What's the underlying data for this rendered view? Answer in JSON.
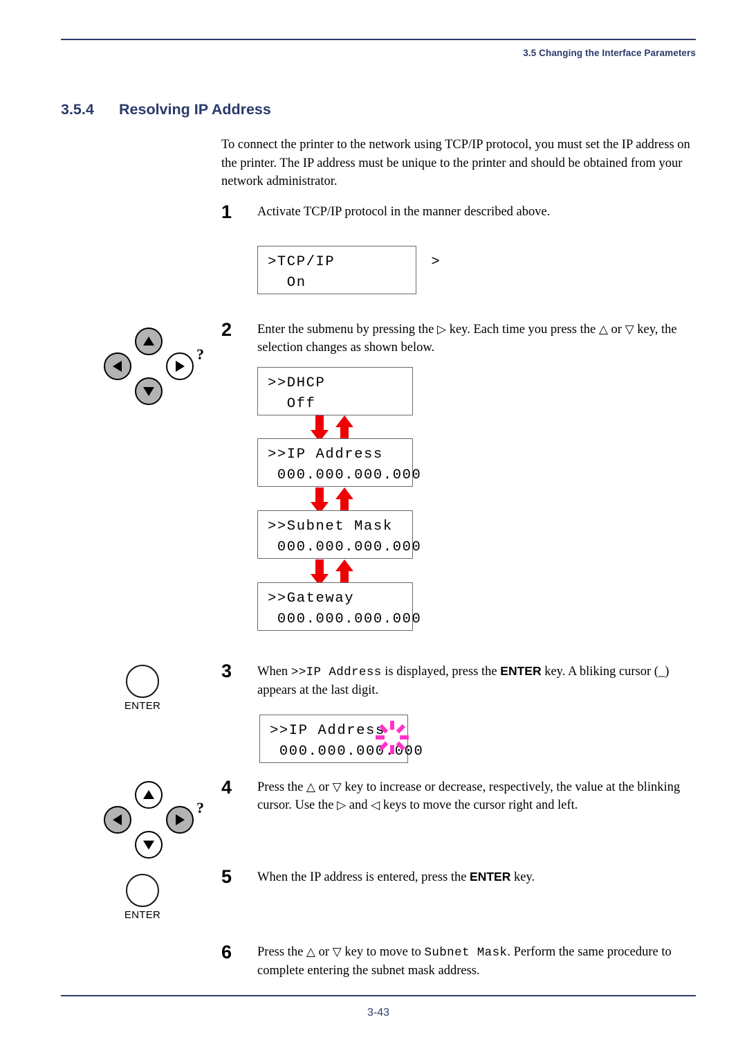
{
  "header": {
    "running_title": "3.5 Changing the Interface Parameters"
  },
  "section": {
    "number": "3.5.4",
    "title": "Resolving IP Address"
  },
  "intro": "To connect the printer to the network using TCP/IP protocol, you must set the IP address on the printer. The IP address must be unique to the printer and should be obtained from your network administrator.",
  "steps": {
    "one": {
      "num": "1",
      "text": "Activate TCP/IP protocol in the manner described above."
    },
    "two": {
      "num": "2",
      "part1": "Enter the submenu by pressing the ",
      "key_right": "▷",
      "part2": " key. Each time you press the ",
      "key_up": "△",
      "or": " or ",
      "key_down": "▽",
      "part3": " key, the selection changes as shown below."
    },
    "three": {
      "num": "3",
      "part1": "When ",
      "mono": ">>IP Address",
      "part2": " is displayed, press the ",
      "enter": "ENTER",
      "part3": " key. A bliking cursor (_) appears at the last digit."
    },
    "four": {
      "num": "4",
      "part1": "Press the ",
      "key_up": "△",
      "or": " or ",
      "key_down": "▽",
      "part2": " key to increase or decrease, respectively, the value at the blinking cursor. Use the ",
      "key_right": "▷",
      "and": " and ",
      "key_left": "◁",
      "part3": " keys to move the cursor right and left."
    },
    "five": {
      "num": "5",
      "part1": "When the IP address is entered, press the ",
      "enter": "ENTER",
      "part2": " key."
    },
    "six": {
      "num": "6",
      "part1": "Press the ",
      "key_up": "△",
      "or": " or ",
      "key_down": "▽",
      "part2": " key to move to ",
      "mono": "Subnet Mask",
      "part3": ". Perform the same procedure to complete entering the subnet mask address."
    }
  },
  "lcd_panels": {
    "tcpip": {
      "line1": ">TCP/IP          >",
      "line2": "  On"
    },
    "dhcp": {
      "line1": ">>DHCP",
      "line2": "  Off"
    },
    "ip": {
      "line1": ">>IP Address",
      "line2": " 000.000.000.000"
    },
    "subnet": {
      "line1": ">>Subnet Mask",
      "line2": " 000.000.000.000"
    },
    "gateway": {
      "line1": ">>Gateway",
      "line2": " 000.000.000.000"
    },
    "ip_blink": {
      "line1": ">>IP Address",
      "line2": " 000.000.000.000"
    }
  },
  "keys": {
    "enter_label": "ENTER",
    "help_glyph": "?"
  },
  "footer": {
    "page_number": "3-43"
  },
  "colors": {
    "accent_blue": "#2b3a6b",
    "arrow_red": "#ee0000",
    "blink_magenta": "#ff33cc",
    "key_fill_gray": "#b3b3b3"
  }
}
